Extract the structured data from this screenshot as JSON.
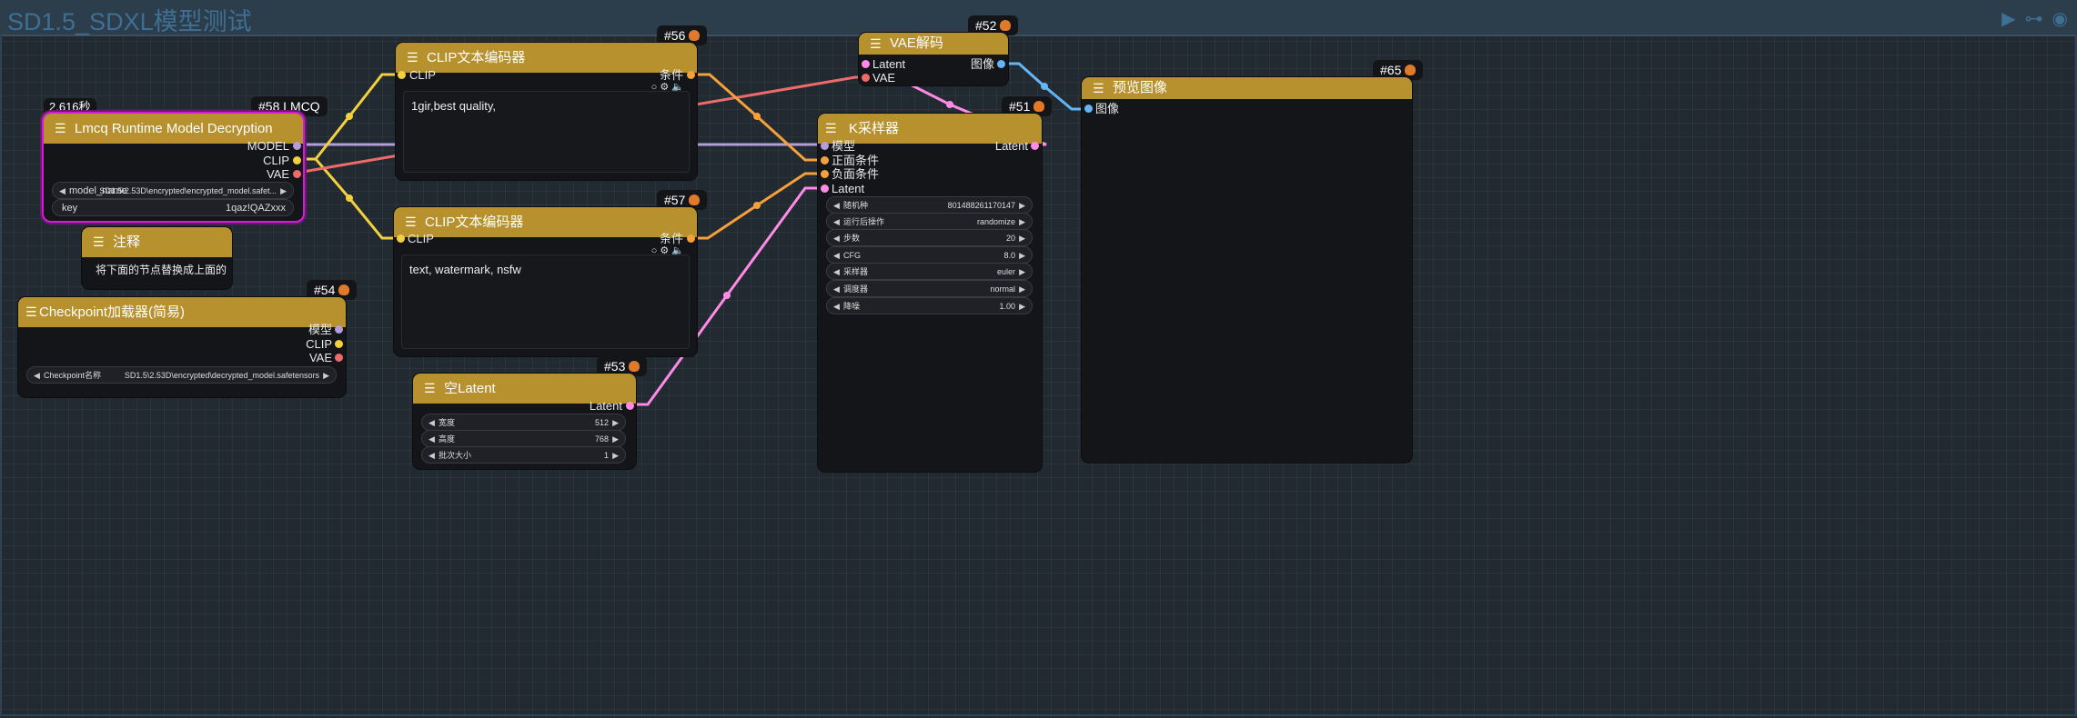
{
  "group": {
    "title": "SD1.5_SDXL模型测试"
  },
  "toolbar": {
    "play_icon": "play-icon",
    "link_icon": "link-icon",
    "eye_icon": "eye-icon"
  },
  "nodes": {
    "lmcq": {
      "badge": "#58 LMCQ",
      "timer": "2.616秒",
      "title": "Lmcq Runtime Model Decryption",
      "outputs": [
        "MODEL",
        "CLIP",
        "VAE"
      ],
      "model_name_label": "model_name",
      "model_name_value": "SD1.5\\2.53D\\encrypted\\encrypted_model.safet...",
      "key_label": "key",
      "key_value": "1qaz!QAZxxx"
    },
    "note": {
      "title": "注释",
      "text": "将下面的节点替换成上面的"
    },
    "checkpoint": {
      "badge": "#54",
      "title": "Checkpoint加载器(简易)",
      "outputs": [
        "模型",
        "CLIP",
        "VAE"
      ],
      "ckpt_label": "Checkpoint名称",
      "ckpt_value": "SD1.5\\2.53D\\encrypted\\decrypted_model.safetensors"
    },
    "clip_pos": {
      "badge": "#56",
      "title": "CLIP文本编码器",
      "input": "CLIP",
      "output": "条件",
      "text": "1gir,best quality,"
    },
    "clip_neg": {
      "badge": "#57",
      "title": "CLIP文本编码器",
      "input": "CLIP",
      "output": "条件",
      "text": "text, watermark, nsfw"
    },
    "latent": {
      "badge": "#53",
      "title": "空Latent",
      "output": "Latent",
      "widgets": [
        {
          "label": "宽度",
          "value": "512"
        },
        {
          "label": "高度",
          "value": "768"
        },
        {
          "label": "批次大小",
          "value": "1"
        }
      ]
    },
    "vae": {
      "badge": "#52",
      "title": "VAE解码",
      "inputs": [
        "Latent",
        "VAE"
      ],
      "output": "图像"
    },
    "ksampler": {
      "badge": "#51",
      "title": "K采样器",
      "inputs": [
        "模型",
        "正面条件",
        "负面条件",
        "Latent"
      ],
      "output": "Latent",
      "widgets": [
        {
          "label": "随机种",
          "value": "801488261170147"
        },
        {
          "label": "运行后操作",
          "value": "randomize"
        },
        {
          "label": "步数",
          "value": "20"
        },
        {
          "label": "CFG",
          "value": "8.0"
        },
        {
          "label": "采样器",
          "value": "euler"
        },
        {
          "label": "调度器",
          "value": "normal"
        },
        {
          "label": "降噪",
          "value": "1.00"
        }
      ]
    },
    "preview": {
      "badge": "#65",
      "title": "预览图像",
      "input": "图像"
    }
  },
  "colors": {
    "model": "#b39ddb",
    "clip": "#f4d03f",
    "vae": "#ef6b6b",
    "cond": "#f5a03a",
    "latent": "#ff8be6",
    "image": "#64b5f6",
    "header": "#b8912f"
  }
}
